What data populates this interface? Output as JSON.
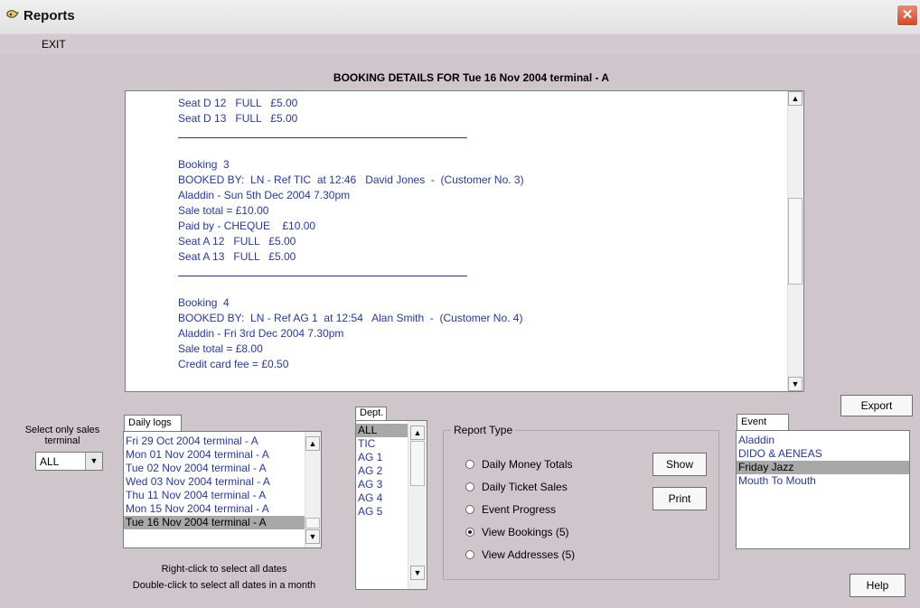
{
  "window": {
    "title": "Reports",
    "close_glyph": "✕"
  },
  "menu": {
    "exit_label": "EXIT"
  },
  "report": {
    "heading": "BOOKING DETAILS FOR Tue 16 Nov 2004 terminal - A",
    "lines": [
      "Seat D 12   FULL   £5.00",
      "Seat D 13   FULL   £5.00",
      "",
      "",
      "Booking  3",
      "BOOKED BY:  LN - Ref TIC  at 12:46   David Jones  -  (Customer No. 3)",
      "Aladdin - Sun 5th Dec 2004 7.30pm",
      "Sale total = £10.00",
      "Paid by - CHEQUE    £10.00",
      "Seat A 12   FULL   £5.00",
      "Seat A 13   FULL   £5.00",
      "",
      "",
      "Booking  4",
      "BOOKED BY:  LN - Ref AG 1  at 12:54   Alan Smith  -  (Customer No. 4)",
      "Aladdin - Fri 3rd Dec 2004 7.30pm",
      "Sale total = £8.00",
      "Credit card fee = £0.50"
    ]
  },
  "terminal": {
    "label": "Select only sales terminal",
    "value": "ALL"
  },
  "daily_logs": {
    "label": "Daily logs",
    "items": [
      "Fri 29 Oct 2004  terminal - A",
      "Mon 01 Nov 2004  terminal - A",
      "Tue 02 Nov 2004  terminal - A",
      "Wed 03 Nov 2004  terminal - A",
      "Thu 11 Nov 2004  terminal - A",
      "Mon 15 Nov 2004  terminal - A",
      "Tue 16 Nov 2004  terminal - A"
    ],
    "selected": "Tue 16 Nov 2004  terminal - A"
  },
  "hints": {
    "line1": "Right-click to select all dates",
    "line2": "Double-click to select all dates in a month"
  },
  "dept": {
    "label": "Dept.",
    "items": [
      "ALL",
      "TIC",
      "AG 1",
      "AG 2",
      "AG 3",
      "AG 4",
      "AG 5"
    ],
    "selected": "ALL"
  },
  "report_type": {
    "label": "Report Type",
    "options": [
      "Daily Money Totals",
      "Daily Ticket Sales",
      "Event Progress",
      "View Bookings (5)",
      "View Addresses (5)"
    ],
    "selected": "View Bookings (5)"
  },
  "buttons": {
    "show": "Show",
    "print": "Print",
    "export": "Export",
    "help": "Help"
  },
  "events": {
    "label": "Event",
    "items": [
      "Aladdin",
      "DIDO & AENEAS",
      "Friday Jazz",
      "Mouth To Mouth"
    ],
    "selected": "Friday Jazz"
  }
}
